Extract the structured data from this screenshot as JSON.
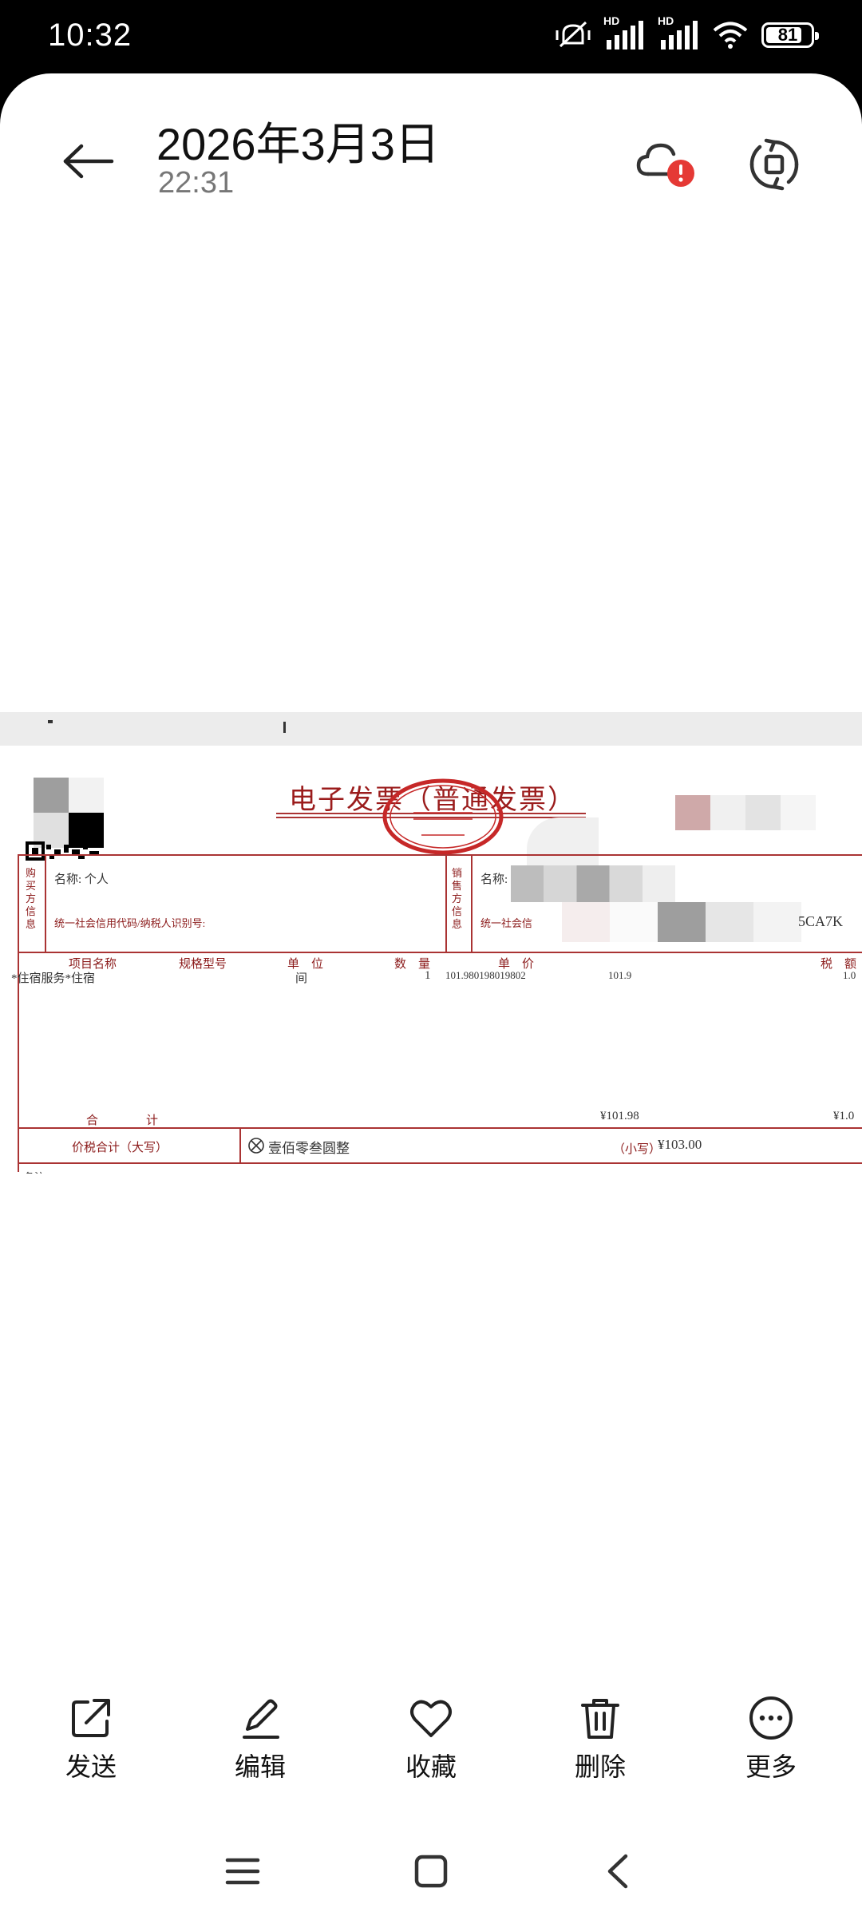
{
  "status_bar": {
    "time": "10:32",
    "battery": "81",
    "battery_level": 0.81,
    "network_labels": [
      "HD",
      "HD"
    ]
  },
  "header": {
    "title": "2026年3月3日",
    "subtitle": "22:31",
    "icons": [
      "back-arrow-icon",
      "cloud-alert-icon",
      "rotate-icon"
    ]
  },
  "invoice": {
    "title": "电子发票（普通发票）",
    "buyer_section_label": "购买方信息",
    "seller_section_label": "销售方信息",
    "buyer_name": "名称: 个人",
    "buyer_tax_id": "统一社会信用代码/纳税人识别号:",
    "seller_name": "名称:",
    "seller_tax_id": "统一社会信",
    "seller_tax_id_tail": "5CA7K",
    "columns": [
      "项目名称",
      "规格型号",
      "单　位",
      "数　量",
      "单　价",
      "税　额"
    ],
    "row": {
      "item": "*住宿服务*住宿",
      "unit": "间",
      "qty": "1",
      "price": "101.980198019802",
      "amount": "101.9",
      "tax": "1.0"
    },
    "total_label": "合　　　　计",
    "total_amount": "¥101.98",
    "total_tax": "¥1.0",
    "grand_label": "价税合计（大写）",
    "grand_words": "壹佰零叁圆整",
    "grand_small_label": "（小写）",
    "grand_small": "¥103.00",
    "footer_cut": "备注"
  },
  "toolbar": {
    "items": [
      {
        "label": "发送",
        "icon": "share-icon"
      },
      {
        "label": "编辑",
        "icon": "pencil-icon"
      },
      {
        "label": "收藏",
        "icon": "heart-icon"
      },
      {
        "label": "删除",
        "icon": "trash-icon"
      },
      {
        "label": "更多",
        "icon": "more-icon"
      }
    ]
  },
  "navbar": {
    "icons": [
      "menu-icon",
      "home-icon",
      "back-icon"
    ]
  },
  "colors": {
    "invoice_red": "#9b1c1c",
    "alert_red": "#e53935"
  }
}
